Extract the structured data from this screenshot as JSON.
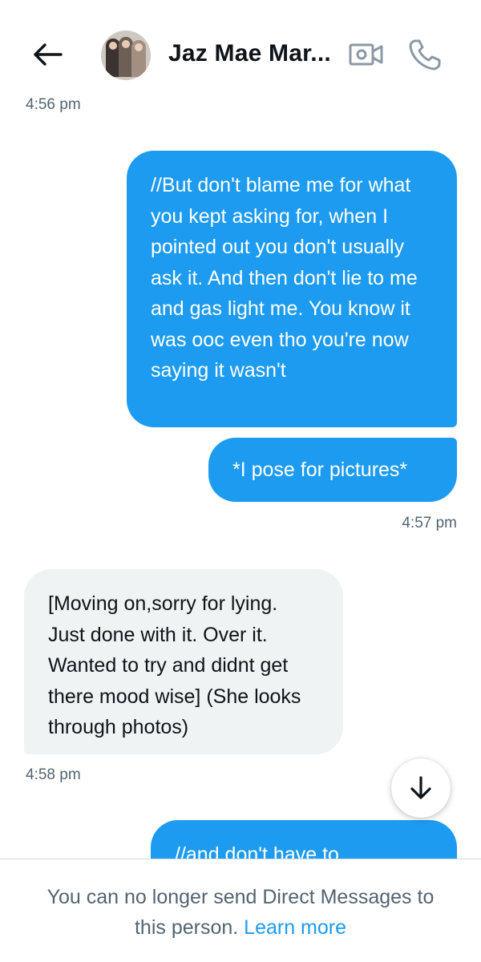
{
  "header": {
    "back_icon": "arrow-left-icon",
    "contact_name": "Jaz Mae Mar...",
    "video_icon": "video-camera-icon",
    "call_icon": "phone-icon"
  },
  "messages": [
    {
      "type": "timestamp",
      "align": "left",
      "text": "4:56 pm"
    },
    {
      "type": "outgoing",
      "text": "//But don't blame me for what you kept asking for, when I pointed out you don't usually ask it. And then don't lie to me and gas light me. You know it was ooc even tho you're now saying it wasn't"
    },
    {
      "type": "outgoing",
      "text": "*I pose for pictures*"
    },
    {
      "type": "timestamp",
      "align": "right",
      "text": "4:57 pm"
    },
    {
      "type": "incoming",
      "text": "[Moving on,sorry for lying. Just done with it. Over it. Wanted to try and didnt get there mood wise]  (She looks through photos)"
    },
    {
      "type": "timestamp",
      "align": "left",
      "text": "4:58 pm"
    },
    {
      "type": "outgoing",
      "text": "//and don't have to"
    }
  ],
  "scroll_down": {
    "icon": "arrow-down-icon"
  },
  "footer": {
    "notice": "You can no longer send Direct Messages to this person.",
    "link": "Learn more"
  },
  "colors": {
    "accent": "#1d9bf0",
    "incoming_bubble": "#eff3f4",
    "secondary_text": "#536471"
  }
}
